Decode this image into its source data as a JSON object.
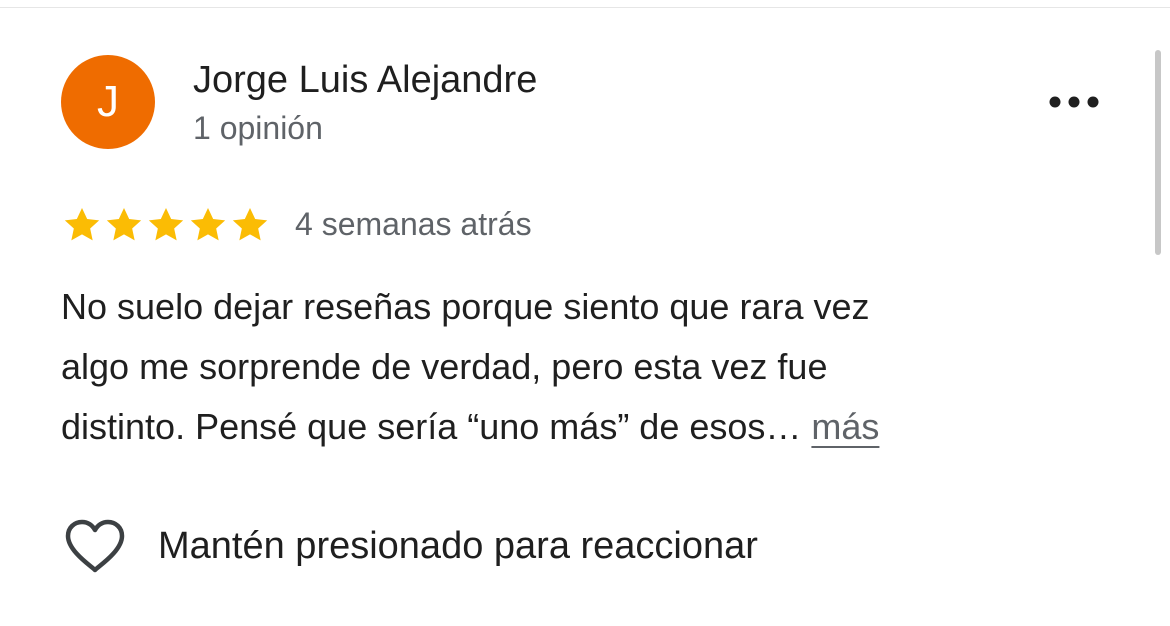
{
  "review": {
    "avatar_initial": "J",
    "reviewer_name": "Jorge Luis Alejandre",
    "review_count": "1 opinión",
    "rating": 5,
    "rating_max": 5,
    "date": "4 semanas atrás",
    "text_lines": [
      "No suelo dejar reseñas porque siento que rara vez",
      "algo me sorprende de verdad, pero esta vez fue",
      "distinto. Pensé que sería “uno más” de esos…"
    ],
    "more_label": "más",
    "reaction_label": "Mantén presionado para reaccionar"
  },
  "icons": {
    "options": "more-horizontal-icon",
    "star": "star-icon",
    "reaction": "heart-outline-icon"
  },
  "colors": {
    "avatar_bg": "#ef6c00",
    "star": "#fbbc04",
    "secondary_text": "#5f6368",
    "primary_text": "#1f1f1f"
  }
}
